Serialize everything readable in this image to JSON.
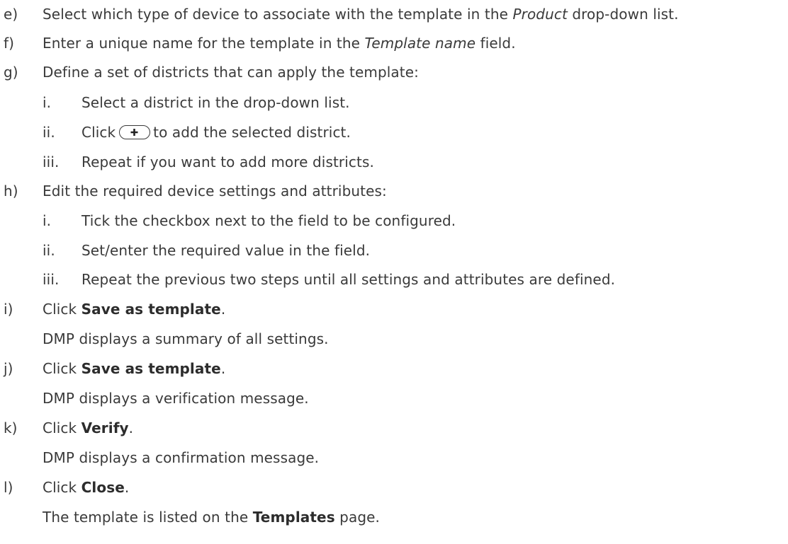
{
  "steps": [
    {
      "label": "e)",
      "pre": "Select which type of device to associate with the template in the ",
      "em": "Product",
      "post": " drop-down list."
    },
    {
      "label": "f)",
      "pre": "Enter a unique name for the template in the ",
      "em": "Template name",
      "post": " field."
    },
    {
      "label": "g)",
      "text": "Define a set of districts that can apply the template:"
    },
    {
      "label": "i.",
      "text": "Select a district in the drop-down list."
    },
    {
      "label": "ii.",
      "pre": "Click",
      "post": "to add the selected district."
    },
    {
      "label": "iii.",
      "text": "Repeat if you want to add more districts."
    },
    {
      "label": "h)",
      "text": "Edit the required device settings and attributes:"
    },
    {
      "label": "i.",
      "text": "Tick the checkbox next to the field to be configured."
    },
    {
      "label": "ii.",
      "text": "Set/enter the required value in the field."
    },
    {
      "label": "iii.",
      "text": "Repeat the previous two steps until all settings and attributes are defined."
    },
    {
      "label": "i)",
      "pre": "Click ",
      "bold": "Save as template",
      "post": "."
    },
    {
      "text": "DMP displays a summary of all settings."
    },
    {
      "label": "j)",
      "pre": "Click ",
      "bold": "Save as template",
      "post": "."
    },
    {
      "text": "DMP displays a verification message."
    },
    {
      "label": "k)",
      "pre": "Click ",
      "bold": "Verify",
      "post": "."
    },
    {
      "text": "DMP displays a confirmation message."
    },
    {
      "label": "l)",
      "pre": "Click ",
      "bold": "Close",
      "post": "."
    },
    {
      "pre": "The template is listed on the ",
      "bold": "Templates",
      "post": " page."
    }
  ],
  "icons": {
    "add_district": "plus-icon"
  }
}
